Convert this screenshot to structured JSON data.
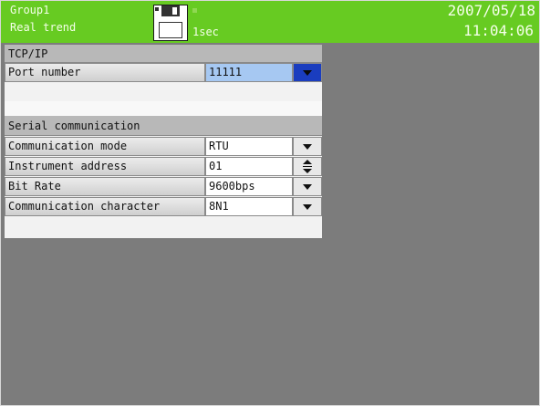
{
  "header": {
    "group_name": "Group1",
    "view_mode": "Real trend",
    "sample_interval": "1sec",
    "date": "2007/05/18",
    "time": "11:04:06",
    "background_color": "#67cb22"
  },
  "tcpip": {
    "section_title": "TCP/IP",
    "port_number": {
      "label": "Port number",
      "value": "11111"
    }
  },
  "serial": {
    "section_title": "Serial communication",
    "communication_mode": {
      "label": "Communication mode",
      "value": "RTU"
    },
    "instrument_address": {
      "label": "Instrument address",
      "value": "01"
    },
    "bit_rate": {
      "label": "Bit Rate",
      "value": "9600bps"
    },
    "communication_character": {
      "label": "Communication character",
      "value": "8N1"
    }
  },
  "icons": {
    "storage": "floppy-disk-icon",
    "dropdown": "chevron-down-icon",
    "spinner": "spinner-icon"
  }
}
